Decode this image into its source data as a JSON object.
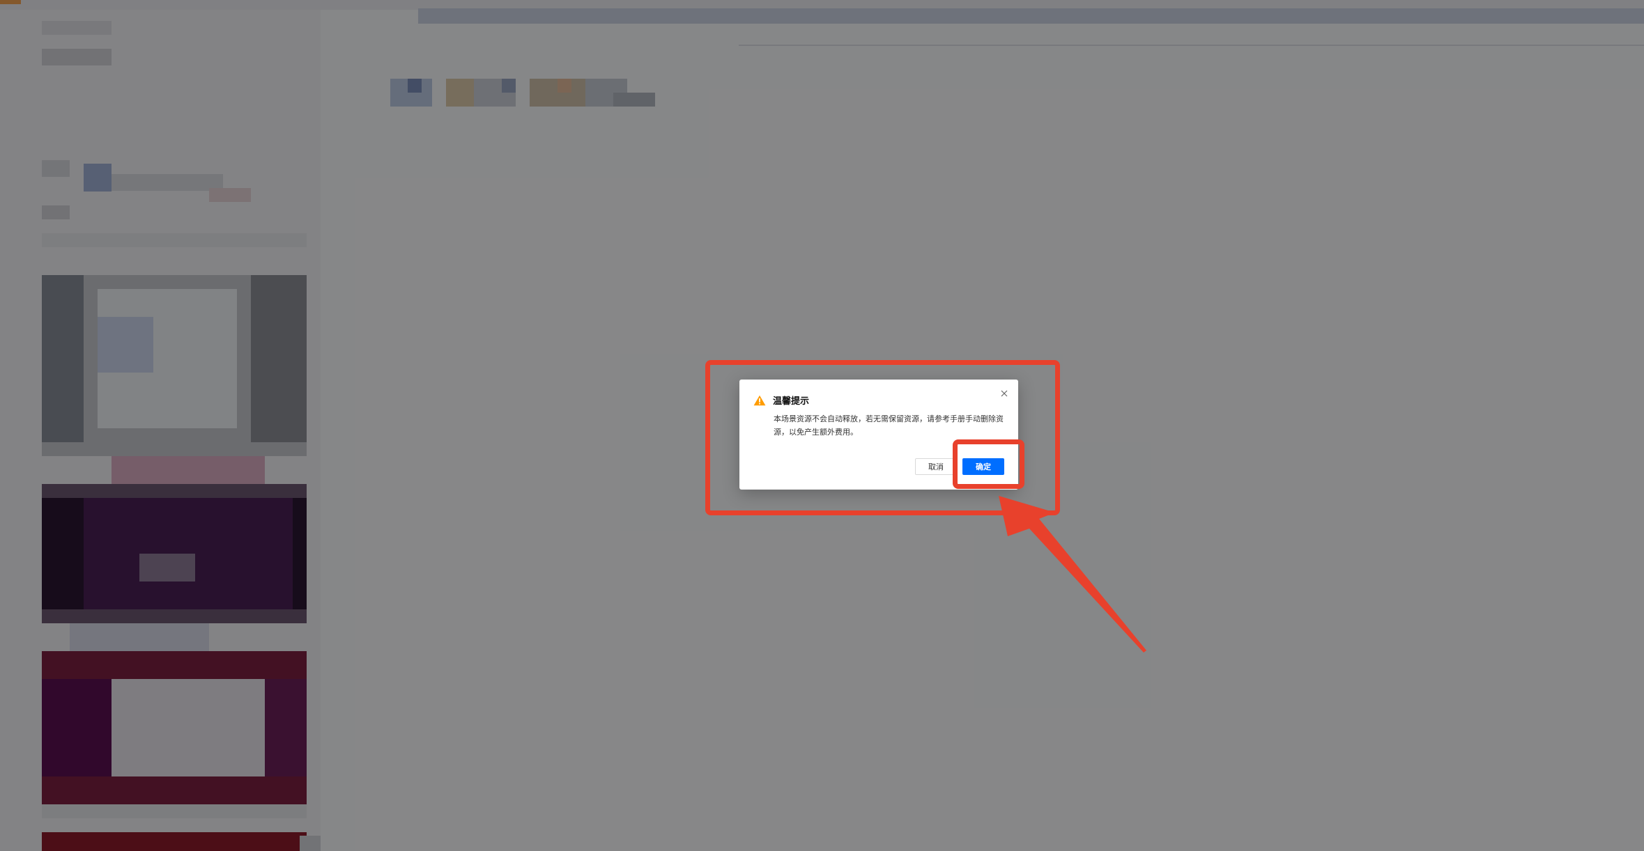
{
  "dialog": {
    "icon": "warning-icon",
    "title": "温馨提示",
    "message": "本场景资源不会自动释放，若无需保留资源，请参考手册手动删除资源，以免产生额外费用。",
    "cancel_label": "取消",
    "ok_label": "确定",
    "close_icon": "close-icon"
  },
  "annotations": {
    "highlight_color": "#e8412c",
    "target": "ok-button"
  },
  "colors": {
    "primary": "#006eff",
    "warning": "#ff9c00",
    "overlay": "rgba(0,0,0,0.45)"
  }
}
